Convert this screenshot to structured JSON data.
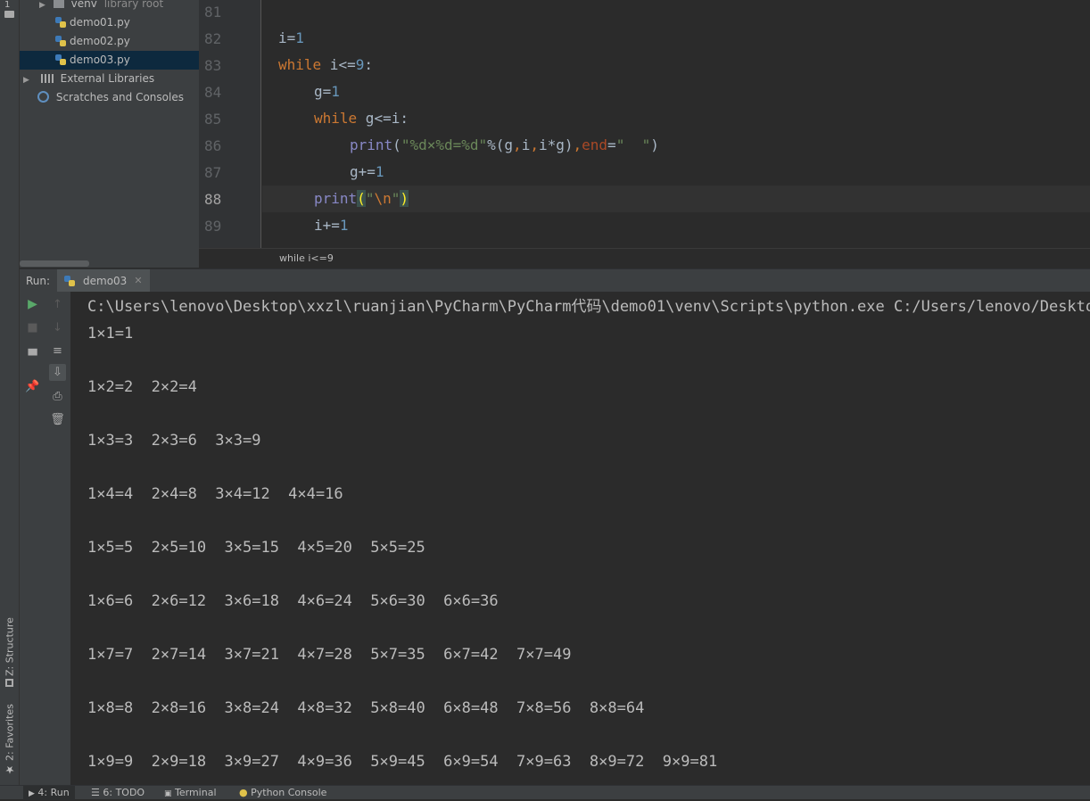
{
  "project_tree": {
    "venv": {
      "name": "venv",
      "hint": "library root"
    },
    "files": [
      "demo01.py",
      "demo02.py",
      "demo03.py"
    ],
    "external_libraries": "External Libraries",
    "scratches": "Scratches and Consoles"
  },
  "editor": {
    "line_numbers": [
      "81",
      "82",
      "83",
      "84",
      "85",
      "86",
      "87",
      "88",
      "89"
    ],
    "breadcrumb": "while i<=9"
  },
  "run_panel": {
    "label": "Run:",
    "tab": "demo03",
    "command": "C:\\Users\\lenovo\\Desktop\\xxzl\\ruanjian\\PyCharm\\PyCharm代码\\demo01\\venv\\Scripts\\python.exe C:/Users/lenovo/Desktop/",
    "output": [
      "1×1=1",
      "1×2=2  2×2=4",
      "1×3=3  2×3=6  3×3=9",
      "1×4=4  2×4=8  3×4=12  4×4=16",
      "1×5=5  2×5=10  3×5=15  4×5=20  5×5=25",
      "1×6=6  2×6=12  3×6=18  4×6=24  5×6=30  6×6=36",
      "1×7=7  2×7=14  3×7=21  4×7=28  5×7=35  6×7=42  7×7=49",
      "1×8=8  2×8=16  3×8=24  4×8=32  5×8=40  6×8=48  7×8=56  8×8=64",
      "1×9=9  2×9=18  3×9=27  4×9=36  5×9=45  6×9=54  7×9=63  8×9=72  9×9=81"
    ]
  },
  "bottom_tabs": [
    "4: Run",
    "6: TODO",
    "Terminal",
    "Python Console"
  ],
  "side_tabs": {
    "structure": "Z: Structure",
    "favorites": "2: Favorites"
  }
}
